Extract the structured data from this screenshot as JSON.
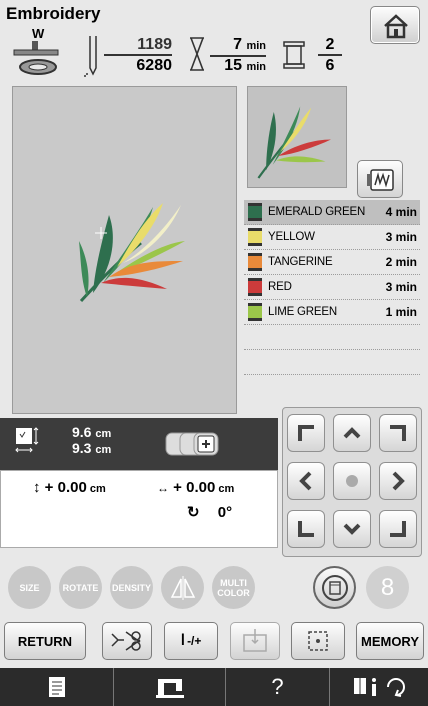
{
  "title": "Embroidery",
  "presser_foot": "W",
  "stitch": {
    "current": "1189",
    "total": "6280"
  },
  "time": {
    "current": "7",
    "total": "15",
    "unit": "min"
  },
  "colors_count": {
    "current": "2",
    "total": "6"
  },
  "thread_list": [
    {
      "name": "EMERALD GREEN",
      "time": "4 min",
      "color": "#2e6f4e",
      "selected": true
    },
    {
      "name": "YELLOW",
      "time": "3 min",
      "color": "#e9dc6a",
      "selected": false
    },
    {
      "name": "TANGERINE",
      "time": "2 min",
      "color": "#e98a3a",
      "selected": false
    },
    {
      "name": "RED",
      "time": "3 min",
      "color": "#cc3b3b",
      "selected": false
    },
    {
      "name": "LIME GREEN",
      "time": "1 min",
      "color": "#9bc64a",
      "selected": false
    }
  ],
  "size": {
    "width": "9.6",
    "height": "9.3",
    "unit": "cm"
  },
  "position": {
    "vertical": "+ 0.00",
    "horizontal": "+ 0.00",
    "unit": "cm",
    "rotation": "0°"
  },
  "edit_buttons": {
    "size": "SIZE",
    "rotate": "ROTATE",
    "density": "DENSITY",
    "multi_color": "MULTI COLOR",
    "digit": "8"
  },
  "bottom_buttons": {
    "return": "RETURN",
    "thread_cut": "-/+",
    "memory": "MEMORY"
  },
  "statusbar": {
    "help": "?"
  }
}
